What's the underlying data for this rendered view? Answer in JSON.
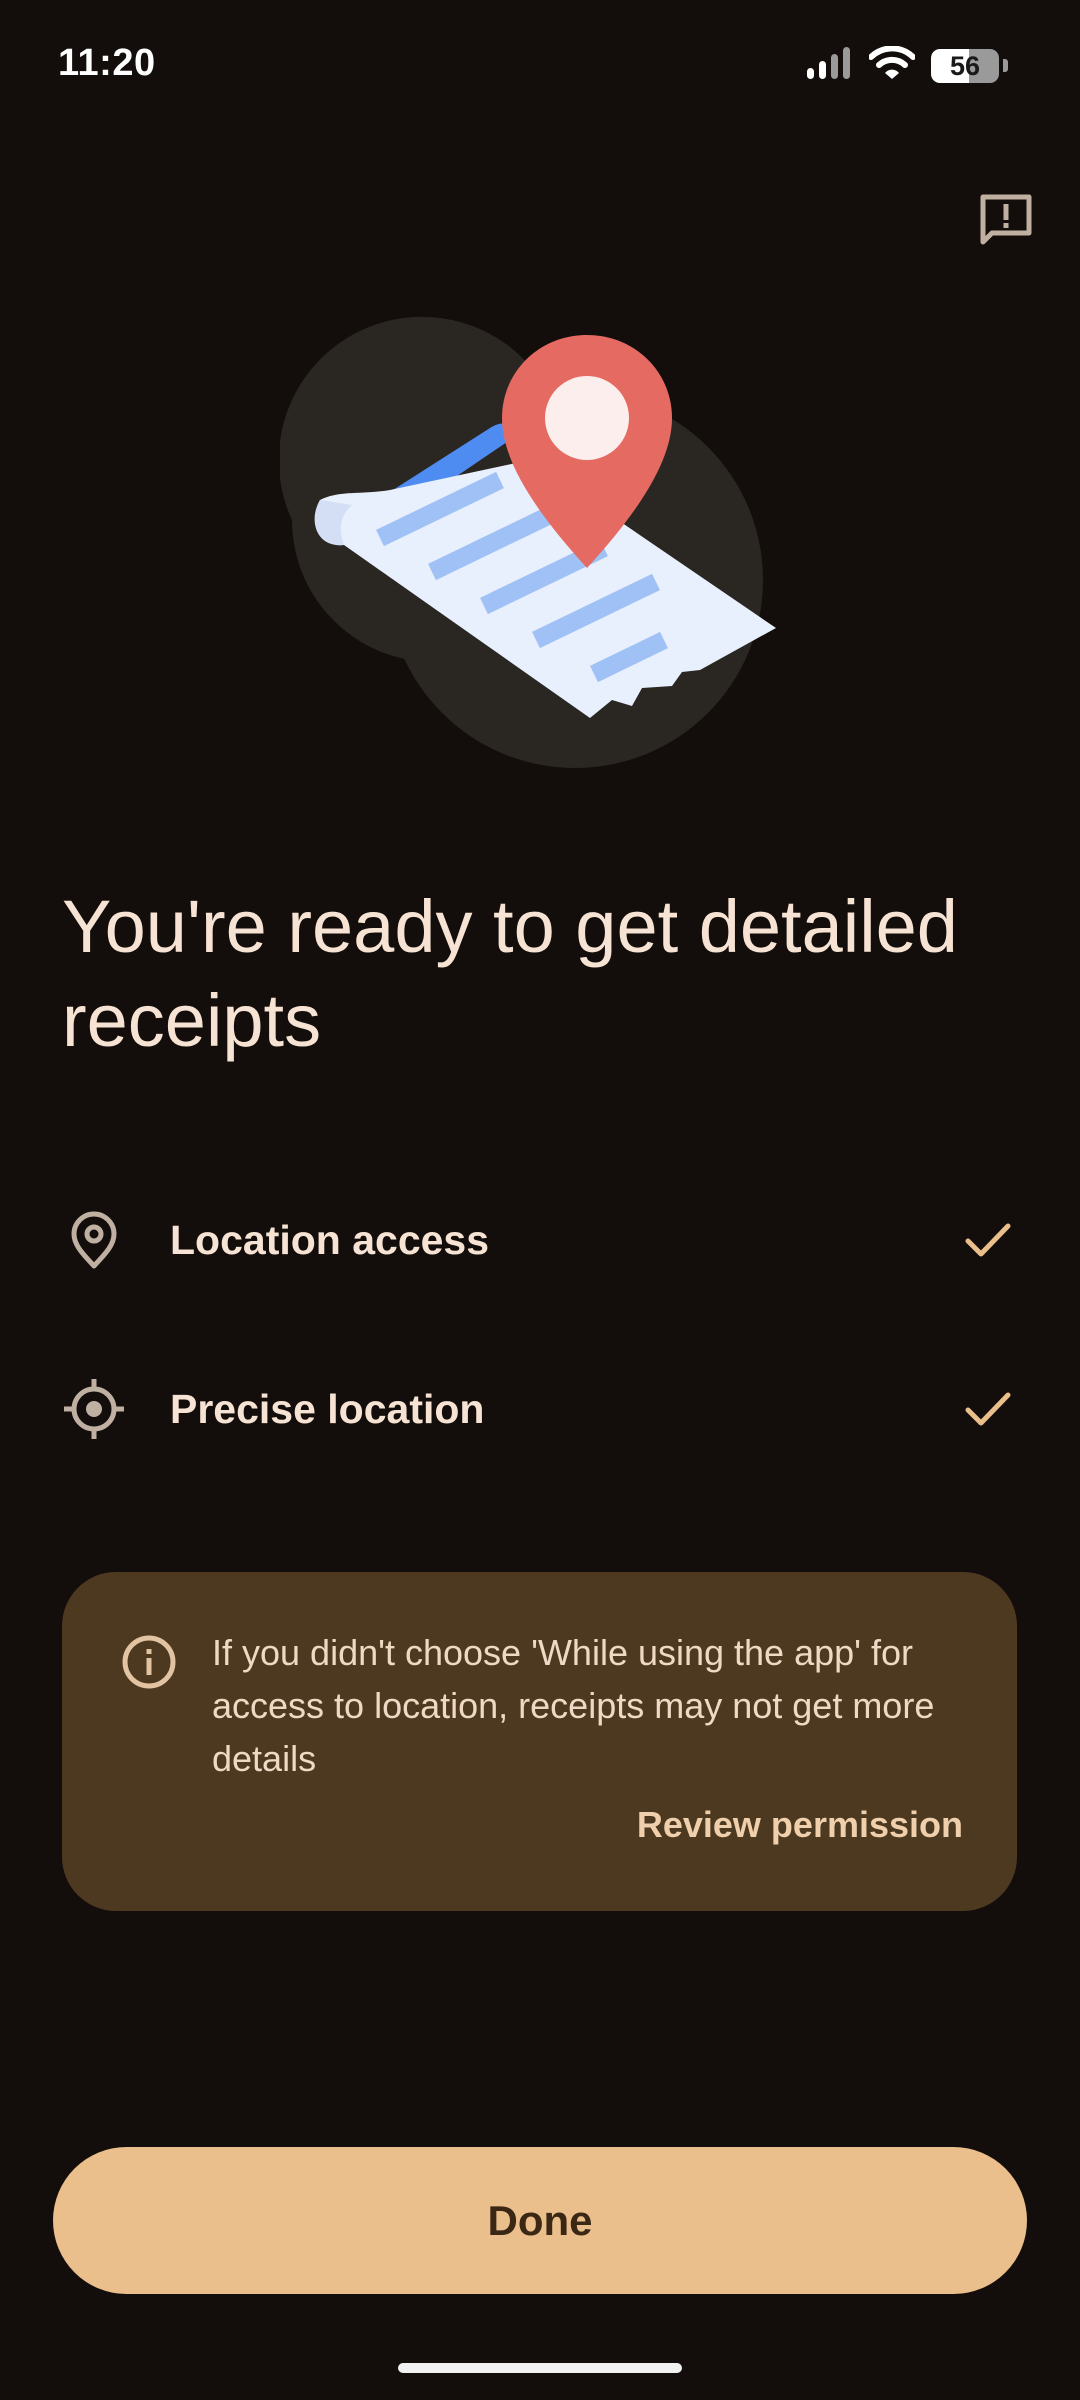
{
  "status_bar": {
    "time": "11:20",
    "battery_level": "56",
    "battery_fill_percent": 56,
    "icons": [
      "signal-icon",
      "wifi-icon",
      "battery-icon"
    ]
  },
  "header": {
    "feedback_icon": "feedback-icon"
  },
  "illustration": {
    "name": "receipt-location-illustration"
  },
  "title": "You're ready to get detailed receipts",
  "permissions": [
    {
      "icon": "location-pin-icon",
      "label": "Location access",
      "status_icon": "check-icon"
    },
    {
      "icon": "precise-location-icon",
      "label": "Precise location",
      "status_icon": "check-icon"
    }
  ],
  "info_card": {
    "icon": "info-icon",
    "text": "If you didn't choose 'While using the app' for access to location, receipts may not get more details",
    "link_label": "Review permission"
  },
  "done_button": {
    "label": "Done"
  },
  "colors": {
    "background": "#130e0b",
    "text": "#f6e3d3",
    "accent": "#eabf8b",
    "card": "#4d3920",
    "pin": "#e56a62",
    "receipt": "#e8effd",
    "receipt_lines": "#9fc1f5",
    "receipt_edge": "#4f8cf1"
  }
}
